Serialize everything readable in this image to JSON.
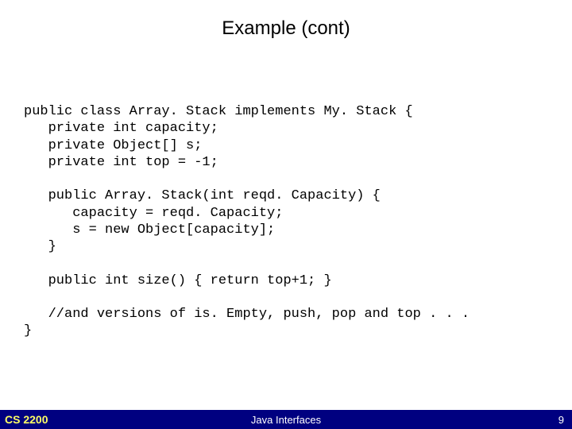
{
  "title": "Example (cont)",
  "code": {
    "l01": "public class Array. Stack implements My. Stack {",
    "l02": "   private int capacity;",
    "l03": "   private Object[] s;",
    "l04": "   private int top = -1;",
    "l05": "",
    "l06": "   public Array. Stack(int reqd. Capacity) {",
    "l07": "      capacity = reqd. Capacity;",
    "l08": "      s = new Object[capacity];",
    "l09": "   }",
    "l10": "",
    "l11": "   public int size() { return top+1; }",
    "l12": "",
    "l13": "   //and versions of is. Empty, push, pop and top . . .",
    "l14": "}"
  },
  "footer": {
    "left": "CS 2200",
    "center": "Java Interfaces",
    "right": "9"
  }
}
